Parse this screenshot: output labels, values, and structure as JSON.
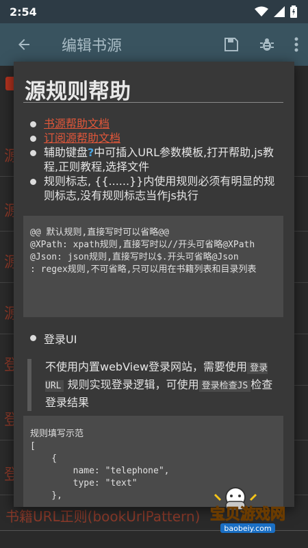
{
  "status_bar": {
    "time": "2:54"
  },
  "app_bar": {
    "title": "编辑书源"
  },
  "background": {
    "rows": [
      "源",
      "源",
      "源",
      "源",
      "登",
      "登",
      "登"
    ],
    "bottom_label": "书籍URL正则(bookUrlPattern)"
  },
  "dialog": {
    "title": "源规则帮助",
    "links": [
      "书源帮助文档",
      "订阅源帮助文档"
    ],
    "item_keyboard": {
      "before": "辅助键盘",
      "after": "中可插入URL参数模板,打开帮助,js教程,正则教程,选择文件"
    },
    "item_rules": "规则标志, {{......}}内使用规则必须有明显的规则标志,没有规则标志当作js执行",
    "code1": "@@ 默认规则,直接写时可以省略@@\n@XPath: xpath规则,直接写时以//开头可省略@XPath\n@Json: json规则,直接写时以$.开头可省略@Json\n: regex规则,不可省略,只可以用在书籍列表和目录列表",
    "login_title": "登录UI",
    "login_desc": {
      "part1": "不使用内置webView登录网站，需要使用",
      "code1": "登录URL",
      "part2": "规则实现登录逻辑，可使用",
      "code2": "登录检查JS",
      "part3": "检查登录结果"
    },
    "code2": "规则填写示范\n[\n    {\n        name: \"telephone\",\n        type: \"text\"\n    },"
  },
  "watermark": {
    "name": "宝贝游戏网",
    "domain": "baobeiy.com"
  },
  "colors": {
    "link": "#e2573a",
    "status_bar": "#2d3b45",
    "app_bar": "#39535f",
    "dialog": "#383838"
  }
}
